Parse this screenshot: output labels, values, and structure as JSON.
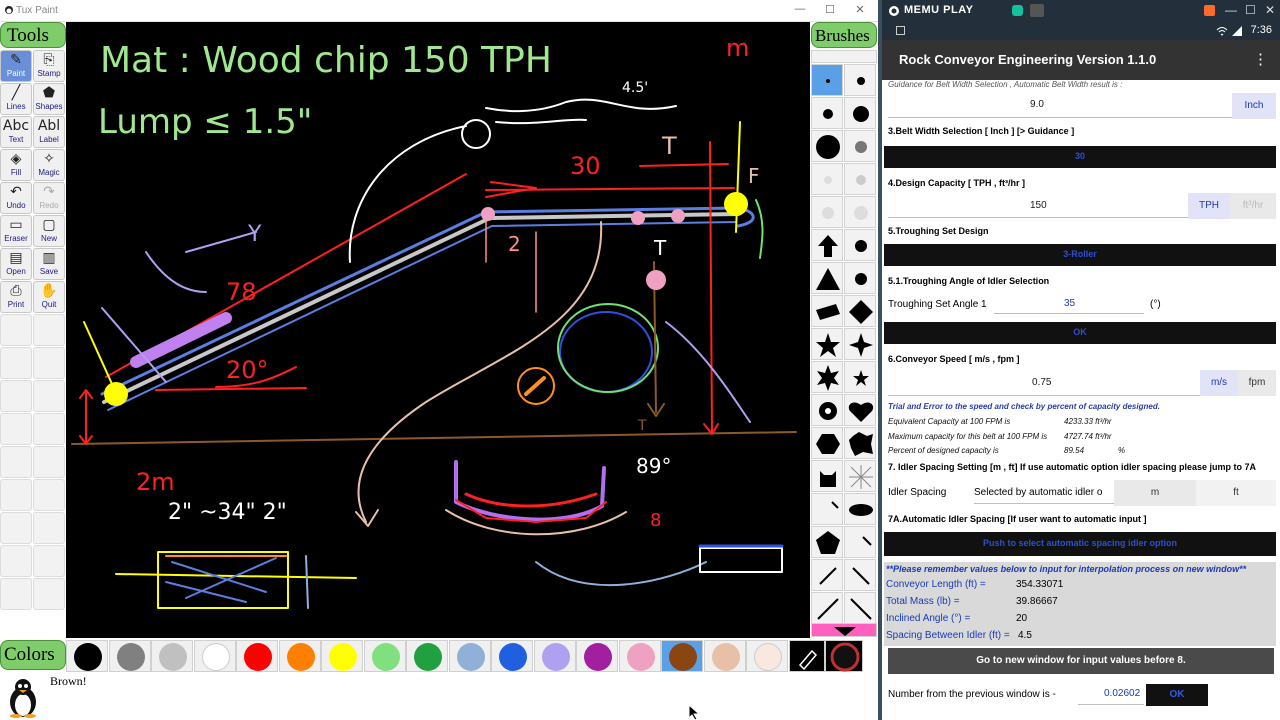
{
  "tuxpaint": {
    "window_title": "Tux Paint",
    "tools_label": "Tools",
    "brushes_label": "Brushes",
    "colors_label": "Colors",
    "status_message": "Brown!",
    "tools": [
      {
        "label": "Paint",
        "icon": "paintbrush-icon",
        "glyph": "✎",
        "selected": true
      },
      {
        "label": "Stamp",
        "icon": "stamp-icon",
        "glyph": "⎘"
      },
      {
        "label": "Lines",
        "icon": "lines-icon",
        "glyph": "╱"
      },
      {
        "label": "Shapes",
        "icon": "shapes-icon",
        "glyph": "⬟"
      },
      {
        "label": "Text",
        "icon": "text-icon",
        "glyph": "Abc"
      },
      {
        "label": "Label",
        "icon": "label-icon",
        "glyph": "Abl"
      },
      {
        "label": "Fill",
        "icon": "fill-icon",
        "glyph": "◈"
      },
      {
        "label": "Magic",
        "icon": "magic-icon",
        "glyph": "✧"
      },
      {
        "label": "Undo",
        "icon": "undo-icon",
        "glyph": "↶"
      },
      {
        "label": "Redo",
        "icon": "redo-icon",
        "glyph": "↷",
        "disabled": true
      },
      {
        "label": "Eraser",
        "icon": "eraser-icon",
        "glyph": "▭"
      },
      {
        "label": "New",
        "icon": "new-icon",
        "glyph": "▢"
      },
      {
        "label": "Open",
        "icon": "open-icon",
        "glyph": "▤"
      },
      {
        "label": "Save",
        "icon": "save-icon",
        "glyph": "▥"
      },
      {
        "label": "Print",
        "icon": "print-icon",
        "glyph": "⎙"
      },
      {
        "label": "Quit",
        "icon": "quit-icon",
        "glyph": "✋"
      }
    ],
    "palette": [
      "#000000",
      "#808080",
      "#c0c0c0",
      "#ffffff",
      "#ff0000",
      "#ff8000",
      "#ffff00",
      "#80e080",
      "#20a040",
      "#90b0d8",
      "#2060e0",
      "#b0a0f0",
      "#a020a0",
      "#f0a0c0",
      "#8b4513",
      "#e8c0a8",
      "#f8e8e0"
    ],
    "selected_color": "#8b4513",
    "drawing_text": {
      "mat": "Mat : Wood chip   150 TPH",
      "lump": "Lump ≤ 1.5\"",
      "unit_m": "m",
      "len30": "30",
      "t1": "T",
      "f": "F",
      "ang20": "20°",
      "len78": "78",
      "y": "Y",
      "m2": "2m",
      "trough": "2\" ~34\" 2\"",
      "ang89": "89°",
      "d45": "4.5'",
      "d2": "2",
      "t2": "T",
      "t3": "T",
      "b8": "8"
    }
  },
  "memu": {
    "brand": "MEMU PLAY",
    "time": "7:36",
    "app_title": "Rock Conveyor Engineering Version 1.1.0",
    "guidance_text": "Guidance for Belt Width Selection , Automatic Belt Width result is :",
    "guidance_value": "9.0",
    "guidance_unit": "Inch",
    "sec3": "3.Belt Width Selection [ Inch ] [> Guidance ]",
    "belt_width_btn": "30",
    "sec4": "4.Design Capacity [ TPH , ft³/hr ]",
    "capacity_value": "150",
    "unit_tph": "TPH",
    "unit_ft3hr": "ft³/hr",
    "sec5": "5.Troughing Set Design",
    "roller_btn": "3-Roller",
    "sec51": "5.1.Troughing Angle of Idler Selection",
    "trough_label": "Troughing Set Angle 1",
    "trough_value": "35",
    "trough_unit": "(°)",
    "ok_btn": "OK",
    "sec6": "6.Conveyor Speed [ m/s , fpm ]",
    "speed_value": "0.75",
    "unit_ms": "m/s",
    "unit_fpm": "fpm",
    "trial_text": "Trial and Error to the speed and check by percent of capacity designed.",
    "eq_cap_label": "Equivalent Capacity at 100 FPM is",
    "eq_cap_value": "4233.33 ft³/hr",
    "max_cap_label": "Maximum capacity for this belt at 100 FPM is",
    "max_cap_value": "4727.74 ft³/hr",
    "pct_label": "Percent of designed capacity is",
    "pct_value": "89.54",
    "pct_unit": "%",
    "sec7": "7. Idler Spacing Setting [m , ft] If use automatic option idler spacing please jump to 7A",
    "idler_label": "Idler Spacing",
    "idler_value": "Selected by automatic idler o",
    "unit_m": "m",
    "unit_ft": "ft",
    "sec7a": "7A.Automatic Idler Spacing [If user want to automatic input ]",
    "auto_btn": "Push to select automatic spacing idler option",
    "remember_text": "**Please remember values below to input for interpolation process on new window**",
    "cl_label": "Conveyor Length (ft) =",
    "cl_value": "354.33071",
    "tm_label": "Total Mass (lb) =",
    "tm_value": "39.86667",
    "ia_label": "Inclined Angle (°) =",
    "ia_value": "20",
    "sp_label": "Spacing Between Idler (ft) = ",
    "sp_value": "4.5",
    "goto_btn": "Go to new window for input values before 8.",
    "prev_label": "Number from the previous window is  -",
    "prev_value": "0.02602",
    "ok2_btn": "OK"
  }
}
